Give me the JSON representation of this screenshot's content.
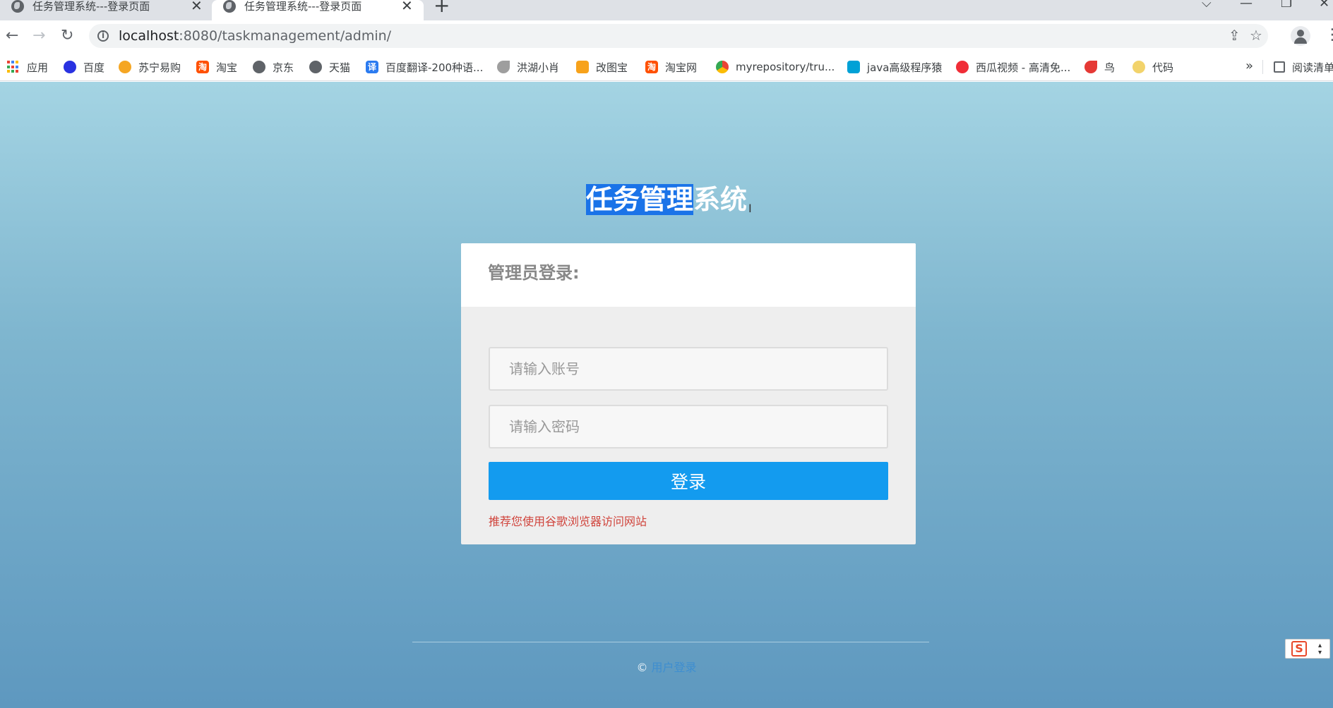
{
  "tabs": [
    {
      "title": "任务管理系统---登录页面",
      "close": "✕"
    },
    {
      "title": "任务管理系统---登录页面",
      "close": "✕"
    }
  ],
  "new_tab_label": "+",
  "window_controls": {
    "dropdown": "⌵",
    "minimize": "—",
    "restore": "❐",
    "close": "✕"
  },
  "nav": {
    "back": "←",
    "forward": "→",
    "reload": "↻"
  },
  "address": {
    "host": "localhost",
    "path": ":8080/taskmanagement/admin/"
  },
  "omnibox_icons": {
    "share": "⇪",
    "star": "☆"
  },
  "menu_glyph": "⋮",
  "bookmarks": [
    {
      "label": "应用",
      "icon": "apps-grid-icon"
    },
    {
      "label": "百度",
      "icon": "baidu-paw-icon",
      "color": "#2932e1"
    },
    {
      "label": "苏宁易购",
      "icon": "suning-lion-icon",
      "color": "#f5a623"
    },
    {
      "label": "淘宝",
      "icon": "taobao-icon",
      "color": "#ff5000",
      "glyph": "淘"
    },
    {
      "label": "京东",
      "icon": "globe-icon",
      "color": "#5f6368"
    },
    {
      "label": "天猫",
      "icon": "globe-icon",
      "color": "#5f6368"
    },
    {
      "label": "百度翻译-200种语...",
      "icon": "baidu-translate-icon",
      "color": "#2b7bf0",
      "glyph": "译"
    },
    {
      "label": "洪湖小肖",
      "icon": "bird-icon",
      "color": "#777777"
    },
    {
      "label": "改图宝",
      "icon": "gaitubao-icon",
      "color": "#f7a21b"
    },
    {
      "label": "淘宝网",
      "icon": "taobao-icon",
      "color": "#ff5000",
      "glyph": "淘"
    },
    {
      "label": "myrepository/tru...",
      "icon": "chrome-icon",
      "color": "#34a853"
    },
    {
      "label": "java高级程序猿",
      "icon": "bilibili-icon",
      "color": "#00a1d6"
    },
    {
      "label": "西瓜视频 - 高清免...",
      "icon": "xigua-icon",
      "color": "#f02d37"
    },
    {
      "label": "鸟",
      "icon": "bird-red-icon",
      "color": "#e53935"
    },
    {
      "label": "代码",
      "icon": "moon-icon",
      "color": "#f2d36b"
    }
  ],
  "bookmarks_more": "»",
  "reading_list": "阅读清单",
  "page": {
    "title_selected": "任务管理",
    "title_rest": "系统",
    "card_header": "管理员登录:",
    "account_placeholder": "请输入账号",
    "password_placeholder": "请输入密码",
    "login_button": "登录",
    "tip": "推荐您使用谷歌浏览器访问网站",
    "footer_symbol": "©",
    "footer_link": "用户登录"
  },
  "colors": {
    "login_button": "#139bef",
    "tip_text": "#d0443c",
    "selection": "#1a73e8",
    "bg_top": "#a4d4e3",
    "bg_bottom": "#5e98bf"
  },
  "sogou_glyph": "S"
}
